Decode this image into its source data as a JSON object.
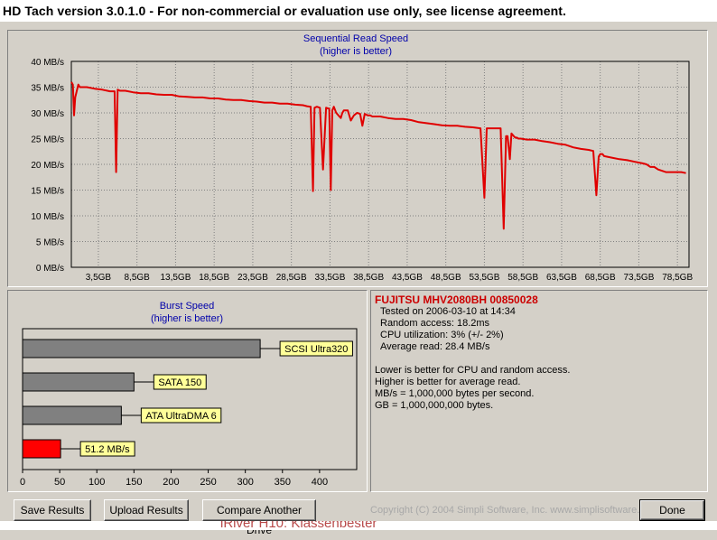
{
  "window": {
    "title": "HD Tach version 3.0.1.0  - For non-commercial or evaluation use only, see license agreement."
  },
  "seq_chart": {
    "title": "Sequential Read Speed",
    "subtitle": "(higher is better)"
  },
  "burst_chart": {
    "title": "Burst Speed",
    "subtitle": "(higher is better)"
  },
  "chart_data": [
    {
      "type": "line",
      "title": "Sequential Read Speed",
      "subtitle": "(higher is better)",
      "xlabel": "",
      "ylabel": "",
      "xlim": [
        0,
        80
      ],
      "ylim": [
        0,
        40
      ],
      "grid": true,
      "colors": {
        "line": "#e00000",
        "grid": "#808080"
      },
      "y_ticks": [
        {
          "value": 0,
          "label": "0 MB/s"
        },
        {
          "value": 5,
          "label": "5 MB/s"
        },
        {
          "value": 10,
          "label": "10 MB/s"
        },
        {
          "value": 15,
          "label": "15 MB/s"
        },
        {
          "value": 20,
          "label": "20 MB/s"
        },
        {
          "value": 25,
          "label": "25 MB/s"
        },
        {
          "value": 30,
          "label": "30 MB/s"
        },
        {
          "value": 35,
          "label": "35 MB/s"
        },
        {
          "value": 40,
          "label": "40 MB/s"
        }
      ],
      "x_ticks": [
        {
          "value": 3.5,
          "label": "3,5GB"
        },
        {
          "value": 8.5,
          "label": "8,5GB"
        },
        {
          "value": 13.5,
          "label": "13,5GB"
        },
        {
          "value": 18.5,
          "label": "18,5GB"
        },
        {
          "value": 23.5,
          "label": "23,5GB"
        },
        {
          "value": 28.5,
          "label": "28,5GB"
        },
        {
          "value": 33.5,
          "label": "33,5GB"
        },
        {
          "value": 38.5,
          "label": "38,5GB"
        },
        {
          "value": 43.5,
          "label": "43,5GB"
        },
        {
          "value": 48.5,
          "label": "48,5GB"
        },
        {
          "value": 53.5,
          "label": "53,5GB"
        },
        {
          "value": 58.5,
          "label": "58,5GB"
        },
        {
          "value": 63.5,
          "label": "63,5GB"
        },
        {
          "value": 68.5,
          "label": "68,5GB"
        },
        {
          "value": 73.5,
          "label": "73,5GB"
        },
        {
          "value": 78.5,
          "label": "78,5GB"
        }
      ],
      "x": [
        0,
        0.2,
        0.35,
        0.5,
        0.9,
        1.1,
        2,
        3,
        4,
        5,
        5.6,
        5.8,
        6.0,
        6.3,
        7,
        8,
        9,
        10,
        11,
        12,
        13,
        14,
        15,
        16,
        17,
        18,
        19,
        20,
        21,
        22,
        23,
        24,
        25,
        26,
        27,
        28,
        29,
        30,
        30.5,
        31,
        31.3,
        31.5,
        31.8,
        32.2,
        32.6,
        33,
        33.4,
        33.6,
        33.8,
        34,
        34.3,
        34.6,
        34.9,
        35.1,
        35.3,
        35.8,
        36.2,
        36.6,
        37,
        37.4,
        37.7,
        38,
        38.4,
        38.7,
        39,
        39.5,
        40,
        41,
        42,
        43,
        44,
        45,
        46,
        47,
        48,
        49,
        50,
        51,
        52,
        53,
        53.5,
        53.8,
        54.2,
        54.6,
        55,
        55.6,
        56,
        56.3,
        56.5,
        56.8,
        57,
        57.3,
        57.5,
        57.7,
        57.9,
        58.2,
        59,
        60,
        61,
        62,
        63,
        64,
        65,
        66,
        67,
        67.6,
        68,
        68.3,
        68.5,
        68.8,
        69,
        70,
        71,
        72,
        73,
        74,
        74.5,
        75,
        75.5,
        76,
        77,
        78,
        78.6,
        79,
        79.6
      ],
      "y": [
        36,
        35.5,
        29.5,
        33,
        35.5,
        35,
        35,
        34.7,
        34.5,
        34.2,
        34.2,
        18.5,
        34.5,
        34.3,
        34.3,
        34,
        33.8,
        33.8,
        33.6,
        33.5,
        33.5,
        33.2,
        33.1,
        33,
        33,
        32.8,
        32.8,
        32.6,
        32.5,
        32.5,
        32.3,
        32.2,
        32,
        32,
        31.8,
        31.8,
        31.6,
        31.5,
        31.3,
        31.2,
        14.8,
        31,
        31.2,
        31,
        19,
        31,
        30.8,
        15,
        30.5,
        31.2,
        30,
        29.5,
        29,
        30,
        30.5,
        30.5,
        28.5,
        29.5,
        30,
        29.8,
        27.5,
        29.8,
        29.5,
        29.5,
        29.3,
        29.3,
        29.3,
        29,
        28.8,
        28.8,
        28.6,
        28.2,
        28,
        27.8,
        27.6,
        27.5,
        27.5,
        27.3,
        27.2,
        27,
        13.5,
        27,
        27,
        27,
        27,
        27,
        7.5,
        25.5,
        25.5,
        21,
        26,
        25.5,
        25.2,
        25.2,
        25,
        25,
        24.8,
        24.8,
        24.5,
        24.3,
        24,
        23.8,
        23.3,
        23,
        22.8,
        22.6,
        14,
        21.5,
        22,
        22,
        21.6,
        21.3,
        21,
        20.8,
        20.5,
        20.2,
        20,
        19.5,
        19.5,
        19,
        18.5,
        18.5,
        18.5,
        18.5,
        18.3
      ]
    },
    {
      "type": "bar",
      "orientation": "horizontal",
      "title": "Burst Speed",
      "subtitle": "(higher is better)",
      "xlabel": "",
      "ylabel": "",
      "xlim": [
        0,
        450
      ],
      "grid": false,
      "x_ticks": [
        0,
        50,
        100,
        150,
        200,
        250,
        300,
        350,
        400
      ],
      "categories": [
        "SCSI Ultra320",
        "SATA 150",
        "ATA UltraDMA 6",
        "51.2 MB/s"
      ],
      "values": [
        320,
        150,
        133,
        51.2
      ],
      "colors": [
        "#808080",
        "#808080",
        "#808080",
        "#ff0000"
      ],
      "label_color": "#ffff99"
    }
  ],
  "drive": {
    "model": "FUJITSU MHV2080BH 00850028",
    "tested_on": "Tested on 2006-03-10 at 14:34",
    "random_access": "Random access: 18.2ms",
    "cpu_utilization": "CPU utilization: 3% (+/- 2%)",
    "average_read": "Average read: 28.4 MB/s"
  },
  "notes": [
    "Lower is better for CPU and random access.",
    "Higher is better for average read.",
    "MB/s = 1,000,000 bytes per second.",
    "GB = 1,000,000,000 bytes."
  ],
  "buttons": {
    "save": "Save Results",
    "upload": "Upload Results",
    "compare": "Compare Another Drive",
    "done": "Done"
  },
  "copyright": "Copyright (C) 2004 Simpli Software, Inc. www.simplisoftware.com",
  "background_text": "iRiver H10: Klassenbester"
}
